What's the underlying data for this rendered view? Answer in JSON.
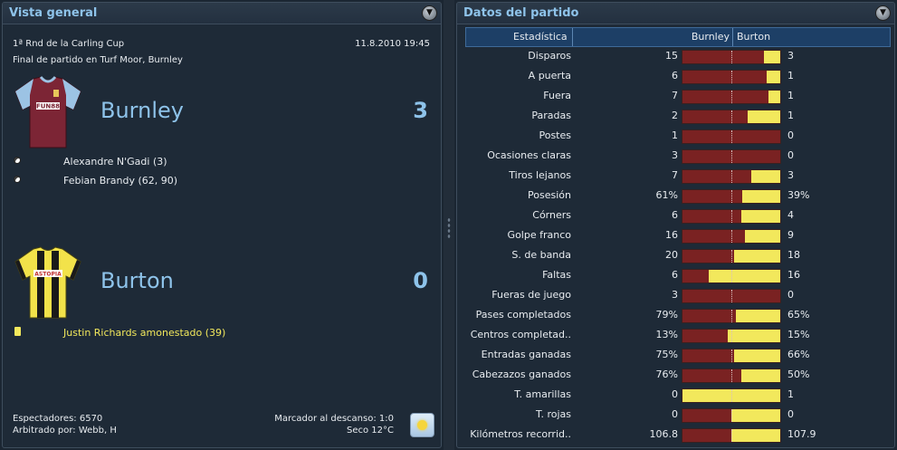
{
  "overview": {
    "title": "Vista general",
    "competition": "1ª Rnd de la Carling Cup",
    "datetime": "11.8.2010 19:45",
    "result_line": "Final de partido en Turf Moor, Burnley",
    "home": {
      "name": "Burnley",
      "score": "3",
      "kit_colors": {
        "body": "#7c2535",
        "sleeves": "#9cc3e4",
        "sponsor": "FUN88"
      },
      "scorers": [
        "Alexandre N'Gadi (3)",
        "Febian Brandy (62, 90)"
      ]
    },
    "away": {
      "name": "Burton",
      "score": "0",
      "kit_colors": {
        "body": "#f2e24a",
        "stripe": "#1a1a1a",
        "sponsor": "ASTOPIA"
      },
      "bookings": [
        "Justin Richards amonestado (39)"
      ]
    },
    "attendance": "Espectadores: 6570",
    "referee": "Arbitrado por: Webb, H",
    "halftime": "Marcador al descanso: 1:0",
    "weather": "Seco 12°C"
  },
  "stats": {
    "title": "Datos del partido",
    "header": {
      "stat": "Estadística",
      "home": "Burnley",
      "away": "Burton"
    },
    "colors": {
      "home": "#7a2222",
      "away": "#f2e85c"
    },
    "rows": [
      {
        "label": "Disparos",
        "home": "15",
        "away": "3",
        "home_share": 0.833
      },
      {
        "label": "A puerta",
        "home": "6",
        "away": "1",
        "home_share": 0.857
      },
      {
        "label": "Fuera",
        "home": "7",
        "away": "1",
        "home_share": 0.875
      },
      {
        "label": "Paradas",
        "home": "2",
        "away": "1",
        "home_share": 0.667
      },
      {
        "label": "Postes",
        "home": "1",
        "away": "0",
        "home_share": 1.0
      },
      {
        "label": "Ocasiones claras",
        "home": "3",
        "away": "0",
        "home_share": 1.0
      },
      {
        "label": "Tiros lejanos",
        "home": "7",
        "away": "3",
        "home_share": 0.7
      },
      {
        "label": "Posesión",
        "home": "61%",
        "away": "39%",
        "home_share": 0.61
      },
      {
        "label": "Córners",
        "home": "6",
        "away": "4",
        "home_share": 0.6
      },
      {
        "label": "Golpe franco",
        "home": "16",
        "away": "9",
        "home_share": 0.64
      },
      {
        "label": "S. de banda",
        "home": "20",
        "away": "18",
        "home_share": 0.526
      },
      {
        "label": "Faltas",
        "home": "6",
        "away": "16",
        "home_share": 0.273
      },
      {
        "label": "Fueras de juego",
        "home": "3",
        "away": "0",
        "home_share": 1.0
      },
      {
        "label": "Pases completados",
        "home": "79%",
        "away": "65%",
        "home_share": 0.549
      },
      {
        "label": "Centros completad..",
        "home": "13%",
        "away": "15%",
        "home_share": 0.464
      },
      {
        "label": "Entradas ganadas",
        "home": "75%",
        "away": "66%",
        "home_share": 0.532
      },
      {
        "label": "Cabezazos ganados",
        "home": "76%",
        "away": "50%",
        "home_share": 0.603
      },
      {
        "label": "T. amarillas",
        "home": "0",
        "away": "1",
        "home_share": 0.0
      },
      {
        "label": "T. rojas",
        "home": "0",
        "away": "0",
        "home_share": 0.5
      },
      {
        "label": "Kilómetros recorrid..",
        "home": "106.8",
        "away": "107.9",
        "home_share": 0.497
      }
    ]
  }
}
